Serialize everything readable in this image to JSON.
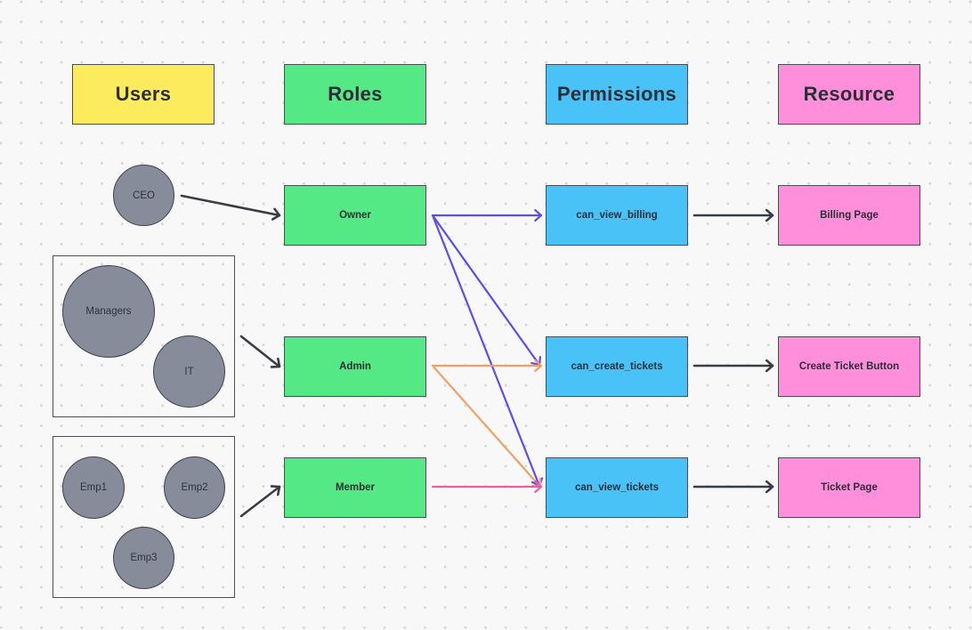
{
  "colors": {
    "users": "#fdeb5e",
    "roles": "#55e986",
    "permissions": "#49c2f8",
    "resource": "#ff8fdb",
    "user_node": "#878c9a",
    "edge_dark": "#3a3d45",
    "edge_owner": "#5b4ef0",
    "edge_admin": "#f0a065",
    "edge_member": "#ec5f9c"
  },
  "headers": {
    "users": "Users",
    "roles": "Roles",
    "permissions": "Permissions",
    "resource": "Resource"
  },
  "users": {
    "ceo": "CEO",
    "managers": "Managers",
    "it": "IT",
    "emp1": "Emp1",
    "emp2": "Emp2",
    "emp3": "Emp3"
  },
  "roles": {
    "owner": "Owner",
    "admin": "Admin",
    "member": "Member"
  },
  "permissions": {
    "can_view_billing": "can_view_billing",
    "can_create_tickets": "can_create_tickets",
    "can_view_tickets": "can_view_tickets"
  },
  "resources": {
    "billing_page": "Billing Page",
    "create_ticket_button": "Create Ticket Button",
    "ticket_page": "Ticket Page"
  },
  "edges": [
    {
      "from": "ceo",
      "to": "owner",
      "color": "edge_dark"
    },
    {
      "from": "managers-it-group",
      "to": "admin",
      "color": "edge_dark"
    },
    {
      "from": "employees-group",
      "to": "member",
      "color": "edge_dark"
    },
    {
      "from": "owner",
      "to": "can_view_billing",
      "color": "edge_owner"
    },
    {
      "from": "owner",
      "to": "can_create_tickets",
      "color": "edge_owner"
    },
    {
      "from": "owner",
      "to": "can_view_tickets",
      "color": "edge_owner"
    },
    {
      "from": "admin",
      "to": "can_create_tickets",
      "color": "edge_admin"
    },
    {
      "from": "admin",
      "to": "can_view_tickets",
      "color": "edge_admin"
    },
    {
      "from": "member",
      "to": "can_view_tickets",
      "color": "edge_member"
    },
    {
      "from": "can_view_billing",
      "to": "billing_page",
      "color": "edge_dark"
    },
    {
      "from": "can_create_tickets",
      "to": "create_ticket_button",
      "color": "edge_dark"
    },
    {
      "from": "can_view_tickets",
      "to": "ticket_page",
      "color": "edge_dark"
    }
  ]
}
